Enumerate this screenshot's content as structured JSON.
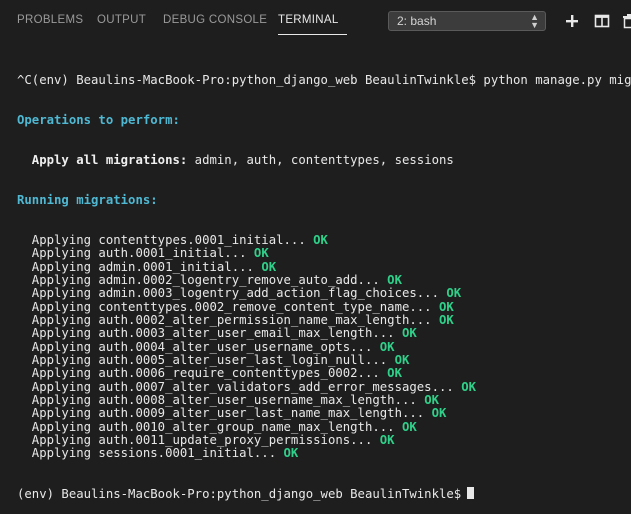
{
  "panel": {
    "tabs": [
      {
        "label": "PROBLEMS",
        "active": false
      },
      {
        "label": "OUTPUT",
        "active": false
      },
      {
        "label": "DEBUG CONSOLE",
        "active": false
      },
      {
        "label": "TERMINAL",
        "active": true
      }
    ],
    "terminal_select": "2: bash",
    "icons": [
      "plus-icon",
      "split-terminal-icon",
      "trash-icon"
    ],
    "colors": {
      "background": "#1e1e1e",
      "cyan": "#4fb8d3",
      "ok": "#2fd18a",
      "text": "#e8e8e8"
    }
  },
  "terminal": {
    "command_line": "^C(env) Beaulins-MacBook-Pro:python_django_web BeaulinTwinkle$ python manage.py migrate",
    "operations_header": "Operations to perform:",
    "apply_label": "  Apply all migrations:",
    "apply_value": " admin, auth, contenttypes, sessions",
    "running_header": "Running migrations:",
    "ok_label": "OK",
    "migrations": [
      "  Applying contenttypes.0001_initial...",
      "  Applying auth.0001_initial...",
      "  Applying admin.0001_initial...",
      "  Applying admin.0002_logentry_remove_auto_add...",
      "  Applying admin.0003_logentry_add_action_flag_choices...",
      "  Applying contenttypes.0002_remove_content_type_name...",
      "  Applying auth.0002_alter_permission_name_max_length...",
      "  Applying auth.0003_alter_user_email_max_length...",
      "  Applying auth.0004_alter_user_username_opts...",
      "  Applying auth.0005_alter_user_last_login_null...",
      "  Applying auth.0006_require_contenttypes_0002...",
      "  Applying auth.0007_alter_validators_add_error_messages...",
      "  Applying auth.0008_alter_user_username_max_length...",
      "  Applying auth.0009_alter_user_last_name_max_length...",
      "  Applying auth.0010_alter_group_name_max_length...",
      "  Applying auth.0011_update_proxy_permissions...",
      "  Applying sessions.0001_initial..."
    ],
    "prompt": "(env) Beaulins-MacBook-Pro:python_django_web BeaulinTwinkle$"
  }
}
